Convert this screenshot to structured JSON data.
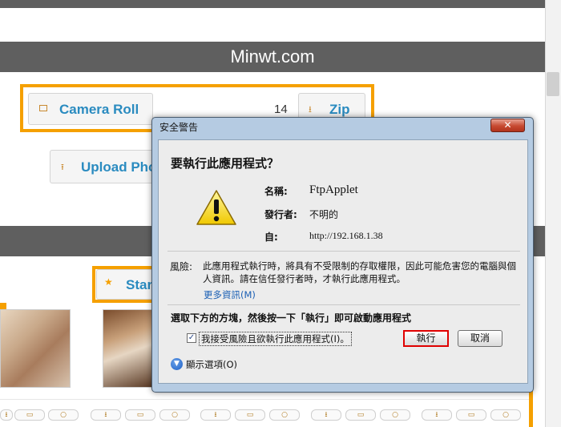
{
  "page": {
    "site_title": "Minwt.com",
    "camera_roll_label": "Camera Roll",
    "photo_count": "14",
    "zip_label": "Zip",
    "upload_label": "Upload Pho",
    "star_label": "Star"
  },
  "dialog": {
    "window_title": "安全警告",
    "close_glyph": "✕",
    "question": "要執行此應用程式？",
    "fields": [
      {
        "label": "名稱:",
        "value": "FtpApplet"
      },
      {
        "label": "發行者:",
        "value": "不明的"
      },
      {
        "label": "自:",
        "value": "http://192.168.1.38"
      }
    ],
    "risk_label": "風險:",
    "risk_text": "此應用程式執行時，將具有不受限制的存取權限，因此可能危害您的電腦與個人資訊。請在信任發行者時，才執行此應用程式。",
    "more_info": "更多資訊(M)",
    "instruction": "選取下方的方塊，然後按一下「執行」即可啟動應用程式",
    "accept_checkbox_label": "我接受風險且欲執行此應用程式(I)。",
    "accept_checked": true,
    "run_button": "執行",
    "cancel_button": "取消",
    "show_options": "顯示選項(O)"
  },
  "colors": {
    "accent_orange": "#f5a000",
    "link_blue": "#2a8bc0",
    "band_gray": "#5f5f5f",
    "run_highlight": "#e00000"
  },
  "icons": {
    "camera_roll": "image-icon",
    "zip": "download-icon",
    "upload": "upload-icon",
    "star": "star-icon",
    "warning": "warning-triangle-icon",
    "show_options": "chevron-down-circle-icon",
    "thumbnail_actions": [
      "download-icon",
      "folder-icon",
      "circle-icon"
    ]
  }
}
